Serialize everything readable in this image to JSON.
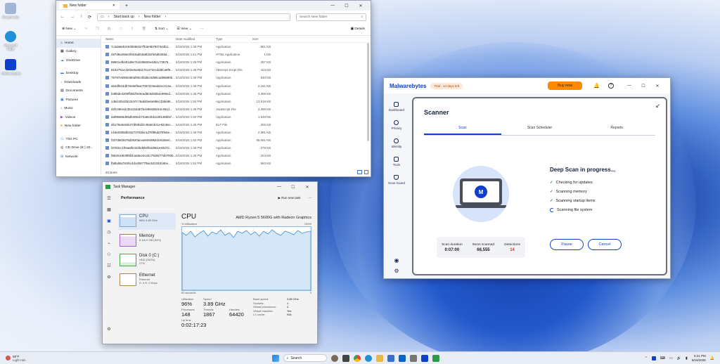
{
  "desktop": {
    "icons": [
      {
        "label": "Recycle Bin",
        "color": "#9fb7d4"
      },
      {
        "label": "Microsoft Edge",
        "color": "#1f8fd8"
      },
      {
        "label": "Malwarebytes",
        "color": "#0d3ecc"
      }
    ]
  },
  "explorer": {
    "tab_title": "New folder",
    "new_tab": "+",
    "controls": [
      "—",
      "☐",
      "✕"
    ],
    "breadcrumb": [
      "Start back up",
      "New folder"
    ],
    "search_placeholder": "Search New folder",
    "toolbar": {
      "new": "New",
      "sort": "Sort",
      "view": "View",
      "more": "···",
      "details": "Details"
    },
    "sidebar": [
      "Home",
      "Gallery",
      "OneDrive",
      "Desktop",
      "Downloads",
      "Documents",
      "Pictures",
      "Music",
      "Videos",
      "New folder",
      "This PC",
      "CD Drive (E:) 20...",
      "Network"
    ],
    "columns": [
      "Name",
      "Date modified",
      "Type",
      "Size"
    ],
    "files": [
      {
        "name": "7c3da8eb3c94b59eb27fb3e9579474edb1...",
        "date": "5/18/2026 1:49 PM",
        "type": "Application",
        "size": "851 KB"
      },
      {
        "name": "487d6a456e3f463ad53a9fd42fe5d6255d...",
        "date": "5/18/2026 1:51 PM",
        "type": "HTML Application",
        "size": "1 KB"
      },
      {
        "name": "98601efb401d8e711b35820e4d51c73975...",
        "date": "5/18/2026 1:49 PM",
        "type": "Application",
        "size": "287 KB"
      },
      {
        "name": "9182751ecb4be8a481174c472ecdd3fca9f9...",
        "date": "5/18/2026 1:48 PM",
        "type": "VBScript Script File",
        "size": "423 KB"
      },
      {
        "name": "76797e6905480af90c0fdd6c0d98cad96890b...",
        "date": "5/18/2026 1:49 PM",
        "type": "Application",
        "size": "630 KB"
      },
      {
        "name": "ab2df544db70e8ef9ae70572c9eab2ec213a...",
        "date": "5/18/2026 1:49 PM",
        "type": "Application",
        "size": "2,161 KB"
      },
      {
        "name": "b39bde4209ff381f9c9ead8e5d0d54e895ed...",
        "date": "5/18/2026 1:48 PM",
        "type": "Application",
        "size": "3,399 KB"
      },
      {
        "name": "cd6442b44b13c97c76a54be6e98ec33de86...",
        "date": "5/18/2026 1:50 PM",
        "type": "Application",
        "size": "13,519 KB"
      },
      {
        "name": "d2fc39eedc354152ab7bcb98436c54c45cd...",
        "date": "5/18/2026 1:49 PM",
        "type": "JavaScript File",
        "size": "3,399 KB"
      },
      {
        "name": "daf95666d05db409cb72a822bb115f148bfa7...",
        "date": "5/18/2026 1:50 PM",
        "type": "Application",
        "size": "1,548 KB"
      },
      {
        "name": "db175e6e6de27d93bd2c49a61b41e92c9ec...",
        "date": "5/18/2026 1:49 PM",
        "type": "ELF File",
        "size": "206 KB"
      },
      {
        "name": "e18e0308db33273762be1d78f9bdd78fe6e...",
        "date": "5/18/2026 1:49 PM",
        "type": "Application",
        "size": "2,981 KB"
      },
      {
        "name": "f337d8d3678d2920acea9494982dc8155e0...",
        "date": "5/18/2026 1:50 PM",
        "type": "Application",
        "size": "95,661 KB"
      },
      {
        "name": "f4783cc1f0aa8fe421bd0b0f54d961e8337d...",
        "date": "5/18/2026 1:49 PM",
        "type": "Application",
        "size": "279 KB"
      },
      {
        "name": "f962910829f9fdcaa5ee0cd4c7929277d0700b...",
        "date": "5/18/2026 1:49 PM",
        "type": "Application",
        "size": "203 KB"
      },
      {
        "name": "fb8bd8a791f6c4dcd0977f5ac52105316be...",
        "date": "5/18/2026 1:52 PM",
        "type": "Application",
        "size": "660 KB"
      }
    ],
    "status": "20 items"
  },
  "taskmgr": {
    "title": "Task Manager",
    "section": "Performance",
    "run_task": "Run new task",
    "more": "···",
    "cards": [
      {
        "name": "CPU",
        "detail": "96% 3.89 GHz"
      },
      {
        "name": "Memory",
        "detail": "5.1/6.0 GB (84%)"
      },
      {
        "name": "Disk 0 (C:)",
        "detail": "HDD (SATA)",
        "detail2": "27%"
      },
      {
        "name": "Ethernet",
        "detail": "Ethernet",
        "detail2": "S: 0 R: 0 Kbps"
      }
    ],
    "cpu_title": "CPU",
    "cpu_model": "AMD Ryzen 5 5600G with Radeon Graphics",
    "util_label": "% Utilization",
    "util_max": "100%",
    "seconds_label": "60 seconds",
    "zero": "0",
    "stats": {
      "utilization_label": "Utilization",
      "utilization": "96%",
      "speed_label": "Speed",
      "speed": "3.89 GHz",
      "processes_label": "Processes",
      "processes": "148",
      "threads_label": "Threads",
      "threads": "1867",
      "handles_label": "Handles",
      "handles": "64420",
      "uptime_label": "Up time",
      "uptime": "0:02:17:23"
    },
    "specs": [
      {
        "k": "Base speed:",
        "v": "3.89 GHz"
      },
      {
        "k": "Sockets:",
        "v": "1"
      },
      {
        "k": "Virtual processors:",
        "v": "4"
      },
      {
        "k": "Virtual machine:",
        "v": "Yes"
      },
      {
        "k": "L1 cache:",
        "v": "N/A"
      }
    ]
  },
  "malwarebytes": {
    "logo": "Malwarebytes",
    "trial": "Trial - 14 days left",
    "buy": "Buy now",
    "nav": [
      "Dashboard",
      "Privacy",
      "Identity",
      "Tools",
      "Scan Guard"
    ],
    "heading": "Scanner",
    "tabs": [
      "Scan",
      "Scan Scheduler",
      "Reports"
    ],
    "status_title": "Deep Scan in progress...",
    "steps": [
      "Checking for updates",
      "Scanning memory",
      "Scanning startup items",
      "Scanning file system"
    ],
    "stats": {
      "duration_label": "Scan duration",
      "duration": "0:07:00",
      "items_label": "Items scanned",
      "items": "66,555",
      "detections_label": "Detections",
      "detections": "14"
    },
    "pause": "Pause",
    "cancel": "Cancel",
    "badge": "M"
  },
  "taskbar": {
    "weather_temp": "59°F",
    "weather_desc": "Light rain",
    "search": "Search",
    "time": "5:31 PM",
    "date": "5/18/2026"
  },
  "colors": {
    "accent": "#0d3ecc",
    "buy": "#ff8a00",
    "detections": "#c0392b"
  }
}
